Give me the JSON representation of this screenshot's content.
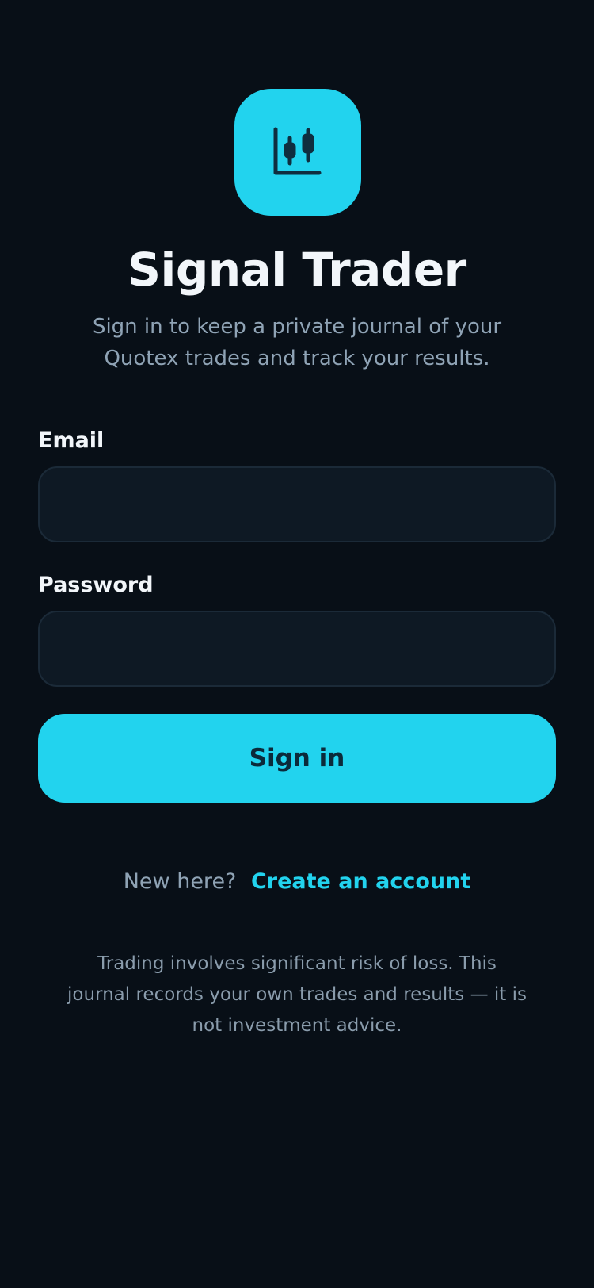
{
  "app": {
    "name": "Signal Trader",
    "subtitle": "Sign in to keep a private journal of your Quotex trades and track your results.",
    "logo_icon": "candlestick-chart-icon"
  },
  "form": {
    "email_label": "Email",
    "email_value": "",
    "email_placeholder": "",
    "password_label": "Password",
    "password_value": "",
    "password_placeholder": "",
    "submit_label": "Sign in"
  },
  "signup": {
    "prompt": "New here?",
    "link_label": "Create an account"
  },
  "disclaimer": "Trading involves significant risk of loss. This journal records your own trades and results — it is not investment advice.",
  "colors": {
    "background": "#080f17",
    "accent": "#22d3ee",
    "input_background": "#0e1924",
    "input_border": "#1b2a38",
    "title_text": "#f2f6fa",
    "muted_text": "#8fa3b5",
    "button_text": "#0b2a3a"
  }
}
